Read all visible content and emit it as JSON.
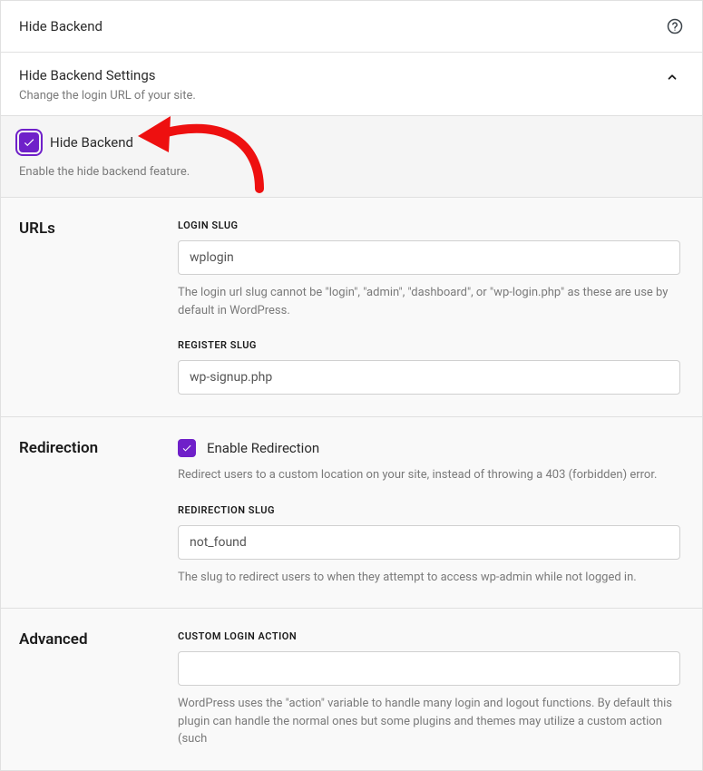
{
  "header": {
    "title": "Hide Backend"
  },
  "settings_header": {
    "title": "Hide Backend Settings",
    "subtitle": "Change the login URL of your site."
  },
  "feature": {
    "label": "Hide Backend",
    "description": "Enable the hide backend feature.",
    "checked": true
  },
  "sections": {
    "urls": {
      "title": "URLs",
      "login_slug": {
        "label": "LOGIN SLUG",
        "value": "wplogin",
        "help": "The login url slug cannot be \"login\", \"admin\", \"dashboard\", or \"wp-login.php\" as these are use by default in WordPress."
      },
      "register_slug": {
        "label": "REGISTER SLUG",
        "value": "wp-signup.php"
      }
    },
    "redirection": {
      "title": "Redirection",
      "enable": {
        "label": "Enable Redirection",
        "checked": true,
        "help": "Redirect users to a custom location on your site, instead of throwing a 403 (forbidden) error."
      },
      "redirect_slug": {
        "label": "REDIRECTION SLUG",
        "value": "not_found",
        "help": "The slug to redirect users to when they attempt to access wp-admin while not logged in."
      }
    },
    "advanced": {
      "title": "Advanced",
      "custom_action": {
        "label": "CUSTOM LOGIN ACTION",
        "value": "",
        "help": "WordPress uses the \"action\" variable to handle many login and logout functions. By default this plugin can handle the normal ones but some plugins and themes may utilize a custom action (such"
      }
    }
  },
  "colors": {
    "accent": "#6f20c9",
    "annotation": "#ee1010"
  }
}
